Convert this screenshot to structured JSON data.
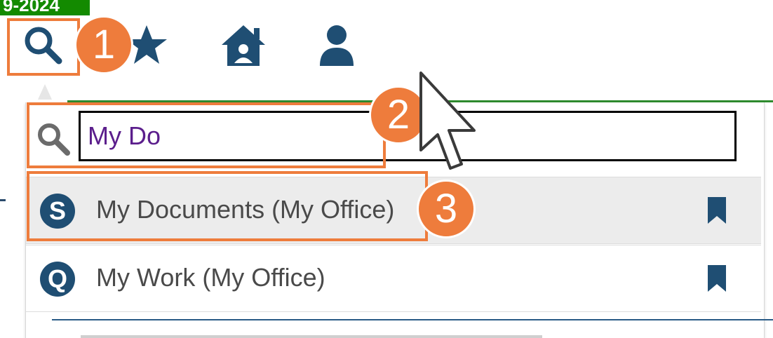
{
  "header": {
    "version_text": "9-2024"
  },
  "toolbar": {
    "icons": [
      "search-icon",
      "star-icon",
      "home-icon",
      "user-icon"
    ]
  },
  "search": {
    "value": "My Do",
    "placeholder": ""
  },
  "results": [
    {
      "badge": "S",
      "label": "My Documents (My Office)",
      "icon": "bookmark-icon"
    },
    {
      "badge": "Q",
      "label": "My Work (My Office)",
      "icon": "bookmark-icon"
    }
  ],
  "callouts": [
    "1",
    "2",
    "3"
  ],
  "colors": {
    "accent": "#ee7c3c",
    "icon_blue": "#1f4e73",
    "green": "#138a00"
  }
}
